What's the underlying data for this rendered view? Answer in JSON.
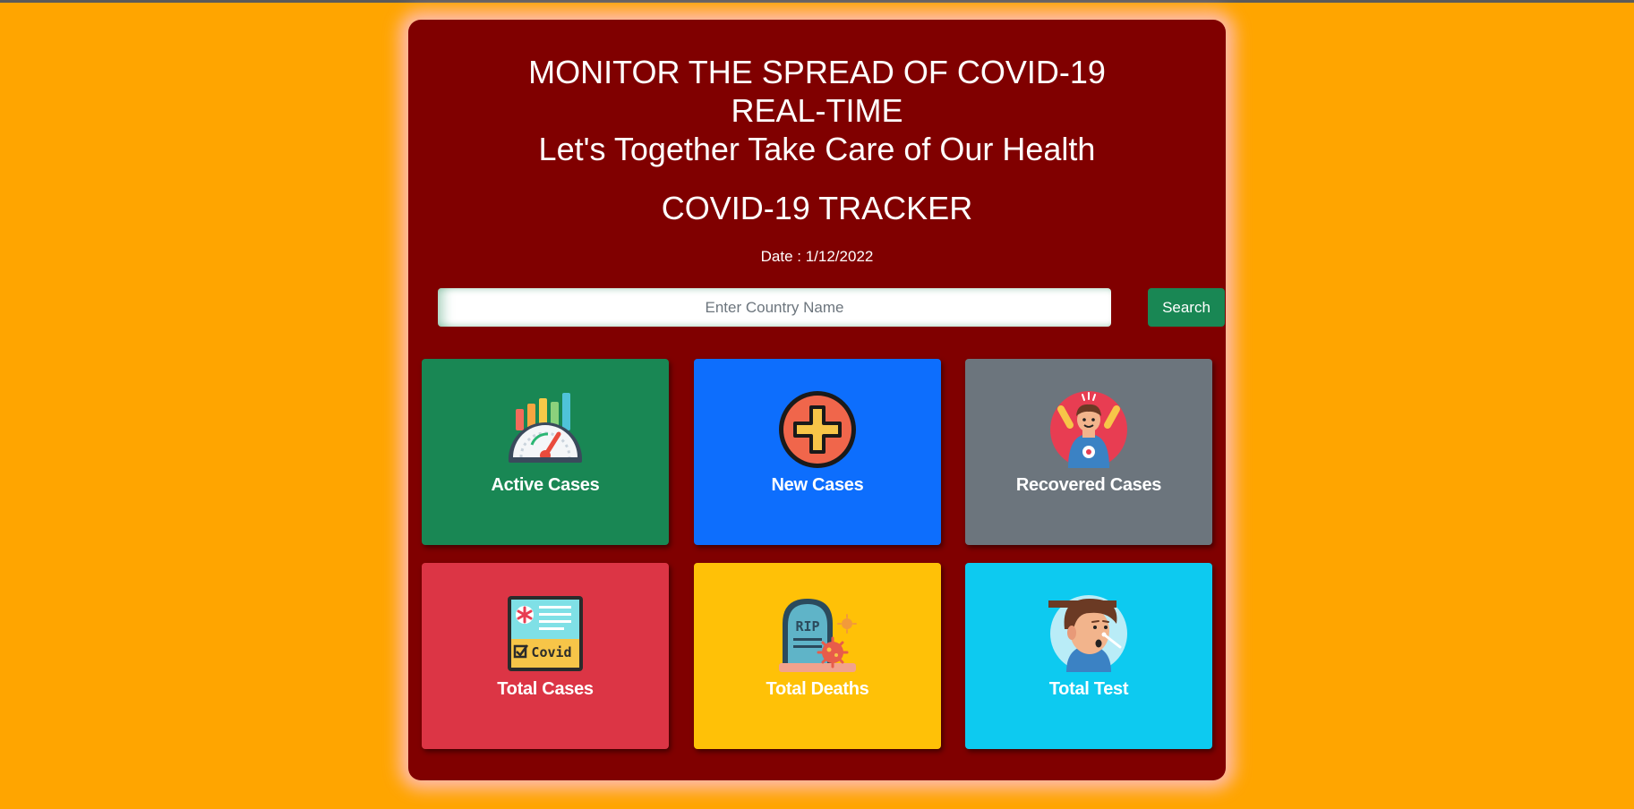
{
  "header": {
    "line1": "MONITOR THE SPREAD OF COVID-19",
    "line2": "REAL-TIME",
    "line3": "Let's Together Take Care of Our Health"
  },
  "title": "COVID-19 TRACKER",
  "date": "Date : 1/12/2022",
  "search": {
    "placeholder": "Enter Country Name",
    "value": "",
    "button_label": "Search"
  },
  "cards": [
    {
      "label": "Active Cases",
      "color": "#198754",
      "icon": "speedometer-icon"
    },
    {
      "label": "New Cases",
      "color": "#0d6efd",
      "icon": "plus-icon"
    },
    {
      "label": "Recovered Cases",
      "color": "#6c757d",
      "icon": "recovered-person-icon"
    },
    {
      "label": "Total Cases",
      "color": "#dc3545",
      "icon": "covid-card-icon"
    },
    {
      "label": "Total Deaths",
      "color": "#ffc107",
      "icon": "tombstone-icon"
    },
    {
      "label": "Total Test",
      "color": "#0dcaf0",
      "icon": "nasal-swab-test-icon"
    }
  ],
  "icon_texts": {
    "covid_card": "Covid",
    "tombstone": "RIP"
  },
  "colors": {
    "page_background": "#FFA500",
    "panel_background": "#800000"
  }
}
